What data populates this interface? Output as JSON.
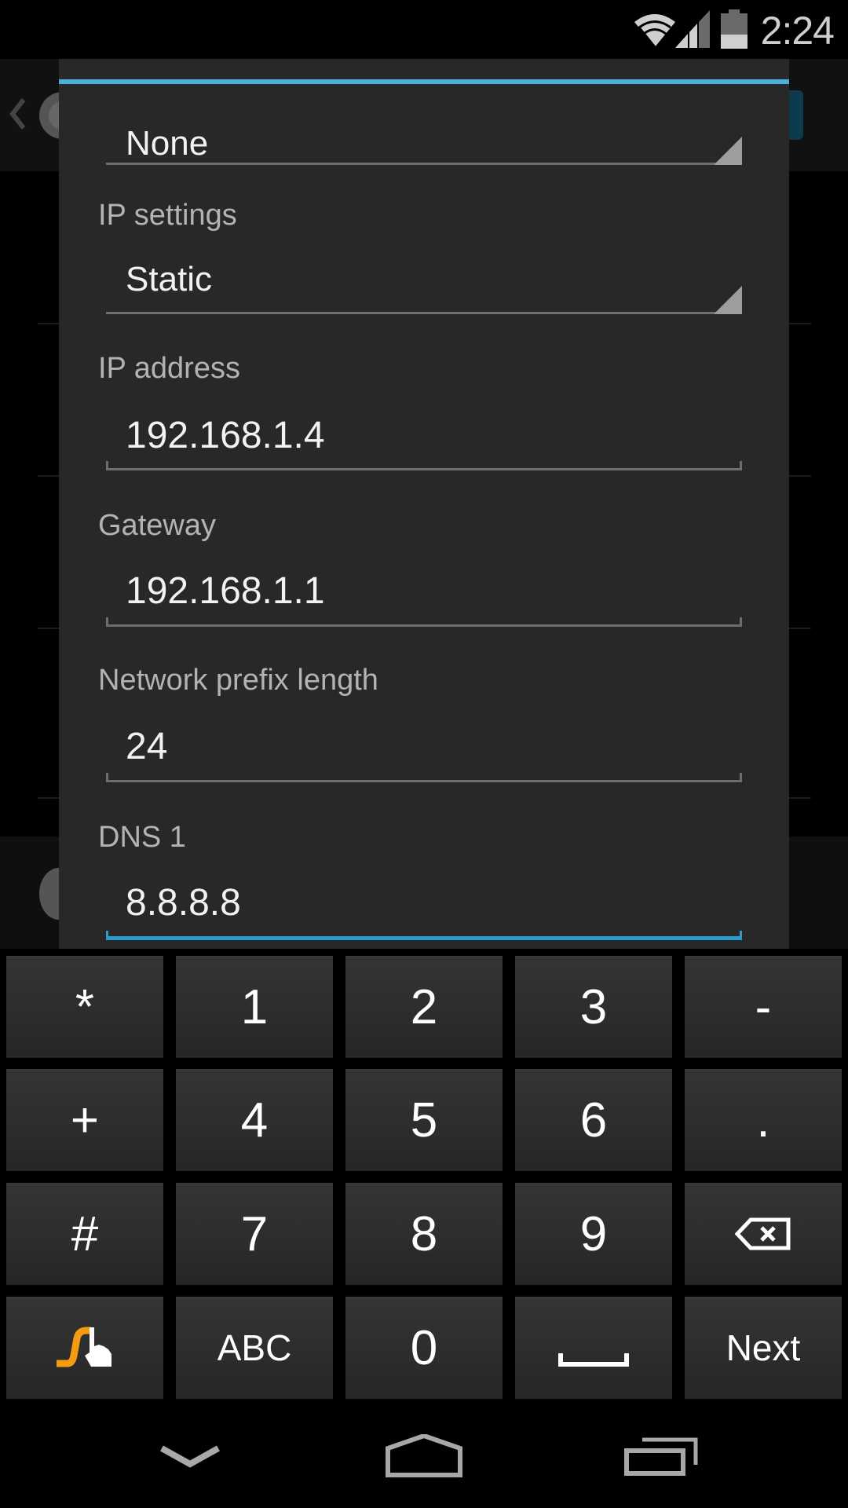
{
  "status_bar": {
    "time": "2:24",
    "icons": [
      "wifi-icon",
      "cell-signal-icon",
      "battery-icon"
    ]
  },
  "background_app": {
    "icons": [
      "back-chevron-icon",
      "settings-gear-icon"
    ]
  },
  "dialog": {
    "top_spinner": {
      "value": "None"
    },
    "ip_settings": {
      "label": "IP settings",
      "value": "Static"
    },
    "ip_address": {
      "label": "IP address",
      "value": "192.168.1.4"
    },
    "gateway": {
      "label": "Gateway",
      "value": "192.168.1.1"
    },
    "prefix_length": {
      "label": "Network prefix length",
      "value": "24"
    },
    "dns1": {
      "label": "DNS 1",
      "value": "8.8.8.8",
      "focused": true
    },
    "accent_color": "#48b0dc"
  },
  "keyboard": {
    "rows": [
      [
        {
          "label": "*",
          "name": "key-asterisk"
        },
        {
          "label": "1",
          "name": "key-1"
        },
        {
          "label": "2",
          "name": "key-2"
        },
        {
          "label": "3",
          "name": "key-3"
        },
        {
          "label": "-",
          "name": "key-minus"
        }
      ],
      [
        {
          "label": "+",
          "name": "key-plus"
        },
        {
          "label": "4",
          "name": "key-4"
        },
        {
          "label": "5",
          "name": "key-5"
        },
        {
          "label": "6",
          "name": "key-6"
        },
        {
          "label": ".",
          "name": "key-period"
        }
      ],
      [
        {
          "label": "#",
          "name": "key-hash"
        },
        {
          "label": "7",
          "name": "key-7"
        },
        {
          "label": "8",
          "name": "key-8"
        },
        {
          "label": "9",
          "name": "key-9"
        },
        {
          "label": "",
          "name": "key-backspace",
          "icon": "backspace-icon"
        }
      ],
      [
        {
          "label": "",
          "name": "key-swype",
          "icon": "swype-icon"
        },
        {
          "label": "ABC",
          "name": "key-abc"
        },
        {
          "label": "0",
          "name": "key-0"
        },
        {
          "label": "",
          "name": "key-space",
          "icon": "space-bar-icon"
        },
        {
          "label": "Next",
          "name": "key-next"
        }
      ]
    ],
    "swype_color": "#f39c12"
  },
  "nav_bar": {
    "buttons": [
      "hide-keyboard-icon",
      "home-icon",
      "recent-apps-icon"
    ]
  }
}
